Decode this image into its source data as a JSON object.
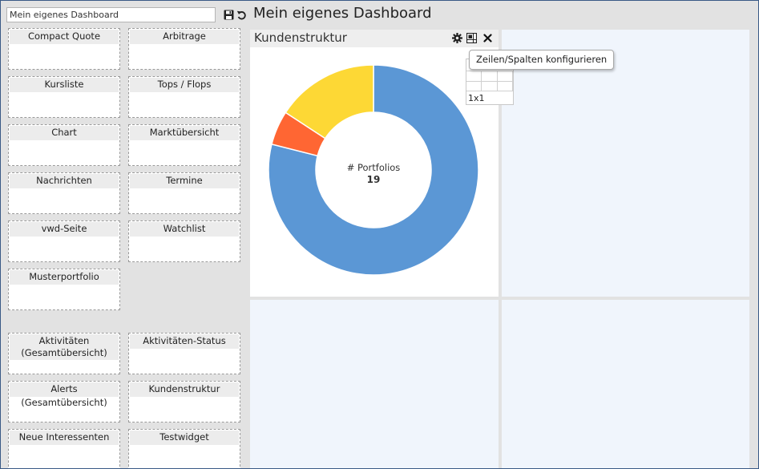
{
  "header": {
    "name_value": "Mein eigenes Dashboard",
    "title": "Mein eigenes Dashboard",
    "save_icon": "save-icon",
    "undo_icon": "undo-icon"
  },
  "palette": {
    "tiles": [
      {
        "label": "Compact Quote"
      },
      {
        "label": "Arbitrage"
      },
      {
        "label": "Kursliste"
      },
      {
        "label": "Tops / Flops"
      },
      {
        "label": "Chart"
      },
      {
        "label": "Marktübersicht"
      },
      {
        "label": "Nachrichten"
      },
      {
        "label": "Termine"
      },
      {
        "label": "vwd-Seite"
      },
      {
        "label": "Watchlist"
      },
      {
        "label": "Musterportfolio"
      },
      {
        "label": "Aktivitäten (Gesamtübersicht)"
      },
      {
        "label": "Aktivitäten-Status"
      },
      {
        "label": "Alerts (Gesamtübersicht)"
      },
      {
        "label": "Kundenstruktur"
      },
      {
        "label": "Neue Interessenten"
      },
      {
        "label": "Testwidget"
      }
    ]
  },
  "widget": {
    "title": "Kundenstruktur",
    "settings_icon": "gear-icon",
    "layout_icon": "grid-config-icon",
    "close_icon": "close-icon"
  },
  "tooltip": {
    "text": "Zeilen/Spalten konfigurieren"
  },
  "size_picker": {
    "label": "1x1"
  },
  "colors": {
    "blue": "#5b97d5",
    "orange": "#ff6633",
    "yellow": "#fdd835",
    "cell_bg": "#f0f5fc"
  },
  "chart_data": {
    "type": "pie",
    "donut": true,
    "center_label": "# Portfolios",
    "center_value": "19",
    "total": 19,
    "slices": [
      {
        "value": 15,
        "color": "#5b97d5"
      },
      {
        "value": 1,
        "color": "#ff6633"
      },
      {
        "value": 3,
        "color": "#fdd835"
      }
    ]
  }
}
